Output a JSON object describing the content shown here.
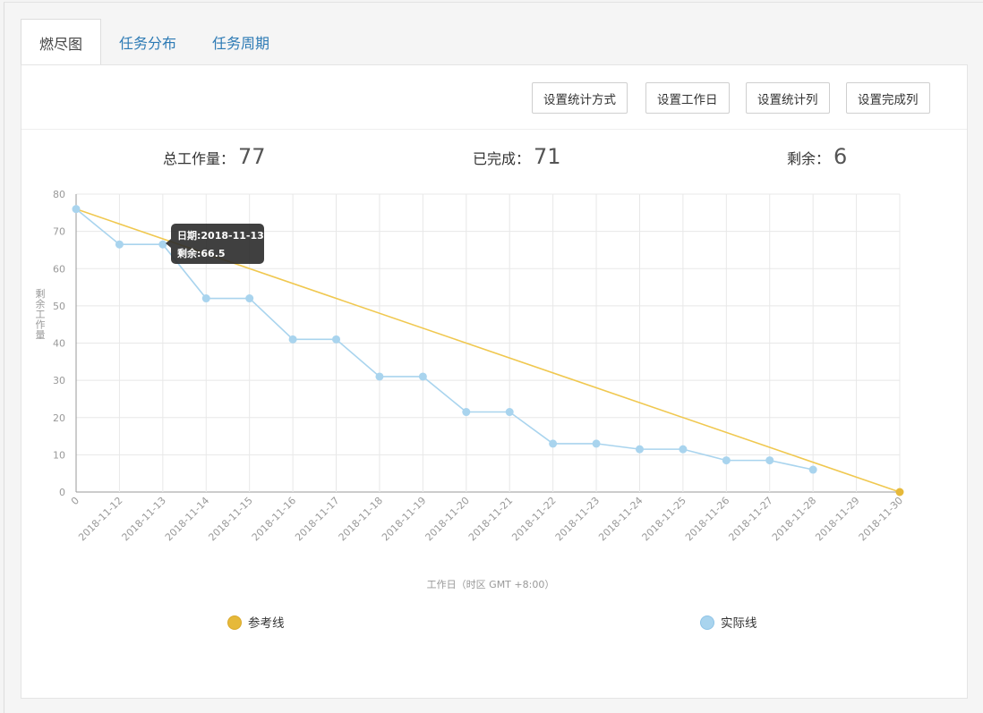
{
  "tabs": [
    {
      "label": "燃尽图",
      "active": true
    },
    {
      "label": "任务分布",
      "active": false
    },
    {
      "label": "任务周期",
      "active": false
    }
  ],
  "toolbar": {
    "buttons": [
      "设置统计方式",
      "设置工作日",
      "设置统计列",
      "设置完成列"
    ]
  },
  "stats": {
    "total_label": "总工作量：",
    "total_value": "77",
    "done_label": "已完成：",
    "done_value": "71",
    "remain_label": "剩余：",
    "remain_value": "6"
  },
  "tooltip": {
    "line1": "日期:2018-11-13",
    "line2": "剩余:66.5"
  },
  "chart_data": {
    "type": "line",
    "ylabel": "剩余工作量",
    "xlabel": "工作日（时区 GMT +8:00）",
    "ylim": [
      0,
      80
    ],
    "yticks": [
      0,
      10,
      20,
      30,
      40,
      50,
      60,
      70,
      80
    ],
    "categories": [
      "0",
      "2018-11-12",
      "2018-11-13",
      "2018-11-14",
      "2018-11-15",
      "2018-11-16",
      "2018-11-17",
      "2018-11-18",
      "2018-11-19",
      "2018-11-20",
      "2018-11-21",
      "2018-11-22",
      "2018-11-23",
      "2018-11-24",
      "2018-11-25",
      "2018-11-26",
      "2018-11-27",
      "2018-11-28",
      "2018-11-29",
      "2018-11-30"
    ],
    "grid": true,
    "legend_position": "bottom",
    "series": [
      {
        "name": "参考线",
        "color": "#f0c850",
        "marker": "#e6b93a",
        "values": [
          76,
          null,
          null,
          null,
          null,
          null,
          null,
          null,
          null,
          null,
          null,
          null,
          null,
          null,
          null,
          null,
          null,
          null,
          null,
          0
        ]
      },
      {
        "name": "实际线",
        "color": "#a9d4ee",
        "marker": "#a9d4ee",
        "values": [
          76,
          66.5,
          66.5,
          52,
          52,
          41,
          41,
          31,
          31,
          21.5,
          21.5,
          13,
          13,
          11.5,
          11.5,
          8.5,
          8.5,
          6,
          null,
          null
        ]
      }
    ]
  }
}
